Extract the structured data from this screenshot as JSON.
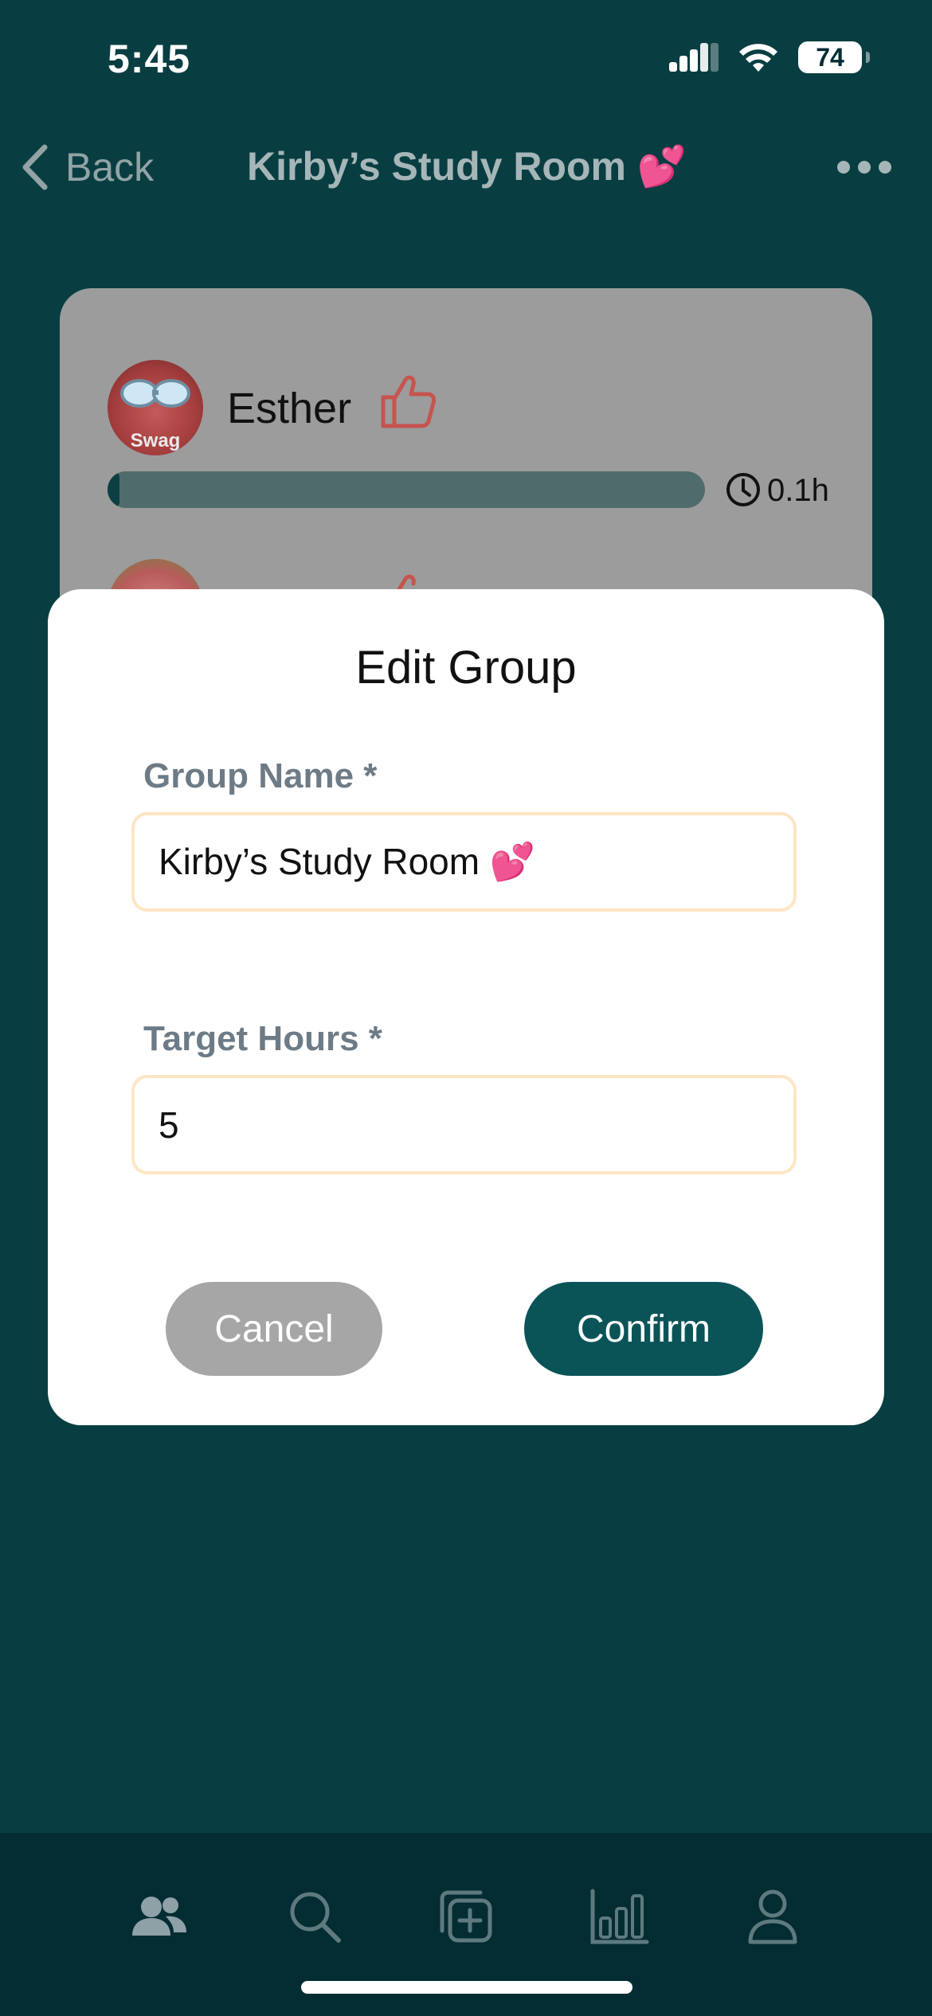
{
  "status_bar": {
    "time": "5:45",
    "battery": "74"
  },
  "nav": {
    "back_label": "Back",
    "title": "Kirby’s Study Room 💕"
  },
  "member": {
    "name": "Esther",
    "avatar_caption": "Swag",
    "progress_fraction": 0.01,
    "hours": "0.1h"
  },
  "modal": {
    "title": "Edit Group",
    "group_name_label": "Group Name *",
    "group_name_value": "Kirby’s Study Room 💕",
    "target_hours_label": "Target Hours *",
    "target_hours_value": "5",
    "cancel_label": "Cancel",
    "confirm_label": "Confirm"
  },
  "colors": {
    "background": "#083e42",
    "tab_bar": "#032c33",
    "confirm_button": "#0a5458",
    "cancel_button": "#a6a6a6",
    "input_border": "#fde6c5",
    "like_icon": "#c6544f"
  },
  "tab_bar": {
    "items": [
      {
        "icon": "groups-icon",
        "active": true
      },
      {
        "icon": "search-icon",
        "active": false
      },
      {
        "icon": "add-group-icon",
        "active": false
      },
      {
        "icon": "stats-icon",
        "active": false
      },
      {
        "icon": "profile-icon",
        "active": false
      }
    ]
  }
}
